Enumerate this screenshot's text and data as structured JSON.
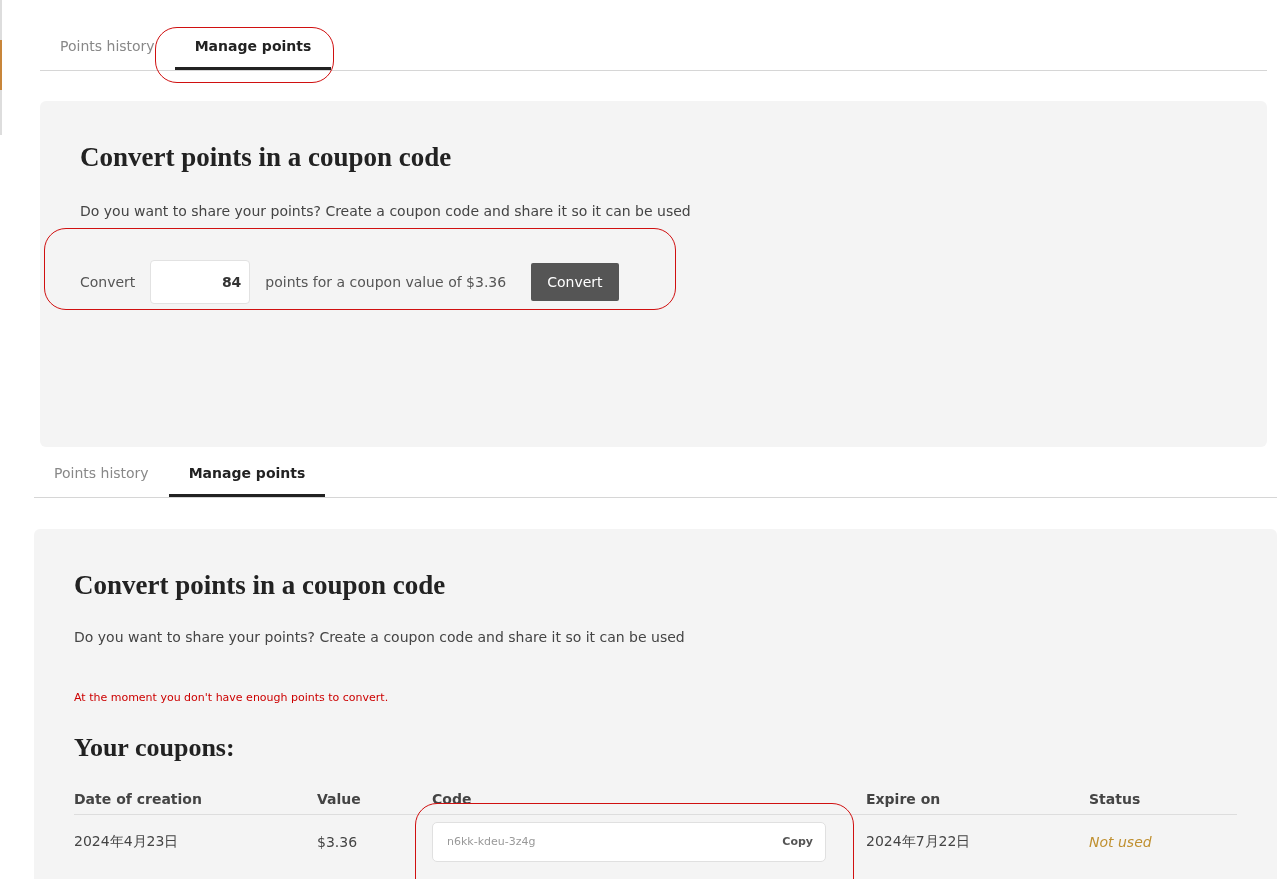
{
  "views": [
    {
      "kind": "convert",
      "tabs": [
        {
          "label": "Points history",
          "selected": false
        },
        {
          "label": "Manage points",
          "selected": true
        }
      ],
      "card": {
        "title": "Convert points in a coupon code",
        "description": "Do you want to share your points? Create a coupon code and share it so it can be used",
        "convert": {
          "prefix": "Convert",
          "value": "84",
          "suffix": "points for a coupon value of $3.36",
          "button": "Convert"
        }
      }
    },
    {
      "kind": "coupons",
      "tabs": [
        {
          "label": "Points history",
          "selected": false
        },
        {
          "label": "Manage points",
          "selected": true
        }
      ],
      "card": {
        "title": "Convert points in a coupon code",
        "description": "Do you want to share your points? Create a coupon code and share it so it can be used",
        "warning": "At the moment you don't have enough points to convert.",
        "coupons_title": "Your coupons:",
        "table": {
          "columns": [
            "Date of creation",
            "Value",
            "Code",
            "Expire on",
            "Status"
          ],
          "rows": [
            {
              "date": "2024年4月23日",
              "value": "$3.36",
              "code": "n6kk-kdeu-3z4g",
              "copy": "Copy",
              "expire": "2024年7月22日",
              "status": "Not used"
            }
          ]
        }
      }
    }
  ]
}
